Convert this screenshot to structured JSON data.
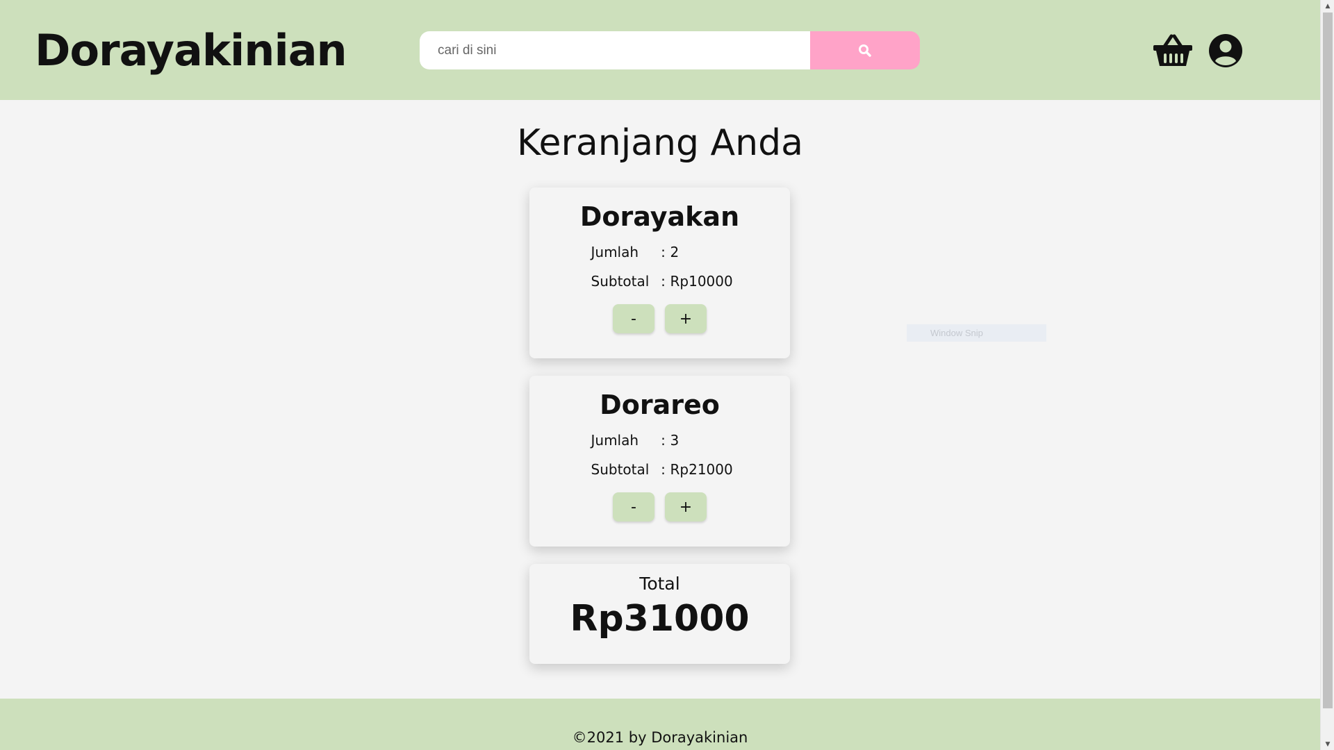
{
  "header": {
    "brand": "Dorayakinian",
    "search_placeholder": "cari di sini",
    "search_button_icon": "search-icon",
    "cart_icon": "basket-icon",
    "account_icon": "user-circle-icon"
  },
  "page": {
    "title": "Keranjang Anda"
  },
  "cart": {
    "items": [
      {
        "name": "Dorayakan",
        "qty_label": "Jumlah",
        "qty": "2",
        "subtotal_label": "Subtotal",
        "subtotal": "Rp10000",
        "separator": ":",
        "decrement_label": "-",
        "increment_label": "+"
      },
      {
        "name": "Dorareo",
        "qty_label": "Jumlah",
        "qty": "3",
        "subtotal_label": "Subtotal",
        "subtotal": "Rp21000",
        "separator": ":",
        "decrement_label": "-",
        "increment_label": "+"
      }
    ],
    "total_label": "Total",
    "total_value": "Rp31000"
  },
  "overlay": {
    "snip_label": "Window Snip"
  },
  "footer": {
    "text": "©2021 by Dorayakinian"
  },
  "colors": {
    "header_bg": "#cde0bc",
    "search_button": "#ffa3c8",
    "page_bg": "#f4f4f4",
    "qty_button": "#cde0bc"
  }
}
